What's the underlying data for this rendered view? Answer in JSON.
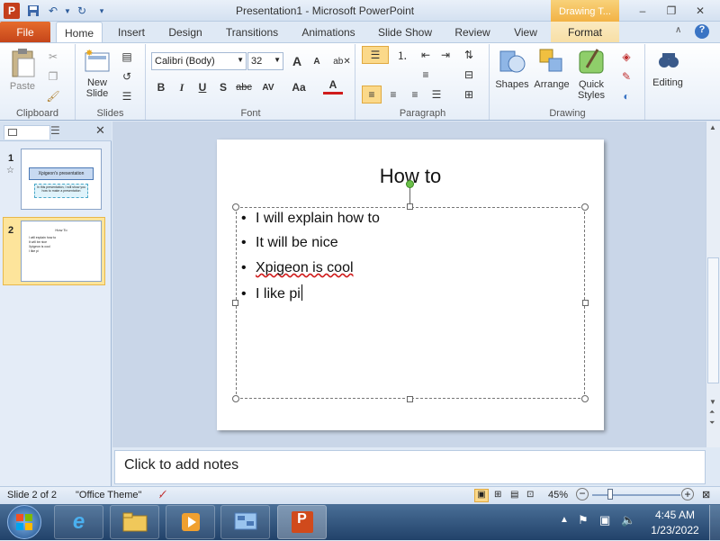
{
  "window": {
    "title": "Presentation1  -  Microsoft PowerPoint",
    "context_tab": "Drawing T...",
    "controls": {
      "minimize": "–",
      "restore": "❐",
      "close": "✕"
    }
  },
  "tabs": {
    "file": "File",
    "items": [
      "Home",
      "Insert",
      "Design",
      "Transitions",
      "Animations",
      "Slide Show",
      "Review",
      "View"
    ],
    "format": "Format"
  },
  "ribbon": {
    "clipboard": {
      "label": "Clipboard",
      "paste": "Paste"
    },
    "slides": {
      "label": "Slides",
      "new_slide": "New Slide"
    },
    "font": {
      "label": "Font",
      "font_name": "Calibri (Body)",
      "font_size": "32",
      "bold": "B",
      "italic": "I",
      "underline": "U",
      "shadow": "S",
      "strike": "abc",
      "spacing": "AV",
      "case": "Aa",
      "color": "A",
      "grow": "A",
      "shrink": "A"
    },
    "paragraph": {
      "label": "Paragraph"
    },
    "drawing": {
      "label": "Drawing",
      "shapes": "Shapes",
      "arrange": "Arrange",
      "quick_styles": "Quick Styles"
    },
    "editing": {
      "label": "Editing"
    }
  },
  "slides_panel": {
    "slides": [
      {
        "number": "1",
        "title": "Xpigeon's presentation",
        "subtitle": "In this presentation, I will show you how to make a presentation"
      },
      {
        "number": "2",
        "title": "How To",
        "lines": [
          "I will explain how to",
          "It will be nice",
          "Xpigeon is cool",
          "I like pi"
        ]
      }
    ]
  },
  "slide": {
    "title": "How to",
    "bullets": [
      "I will explain how to",
      "It will be nice",
      "Xpigeon is cool",
      "I like pi"
    ]
  },
  "notes": {
    "placeholder": "Click to add notes"
  },
  "status": {
    "slide": "Slide 2 of 2",
    "theme": "\"Office Theme\"",
    "zoom": "45%",
    "zoom_level": 0.45
  },
  "taskbar": {
    "time": "4:45 AM",
    "date": "1/23/2022"
  },
  "colors": {
    "file_tab": "#d5551f",
    "context_tab": "#f2b244",
    "selected_thumb": "#fde49b"
  }
}
